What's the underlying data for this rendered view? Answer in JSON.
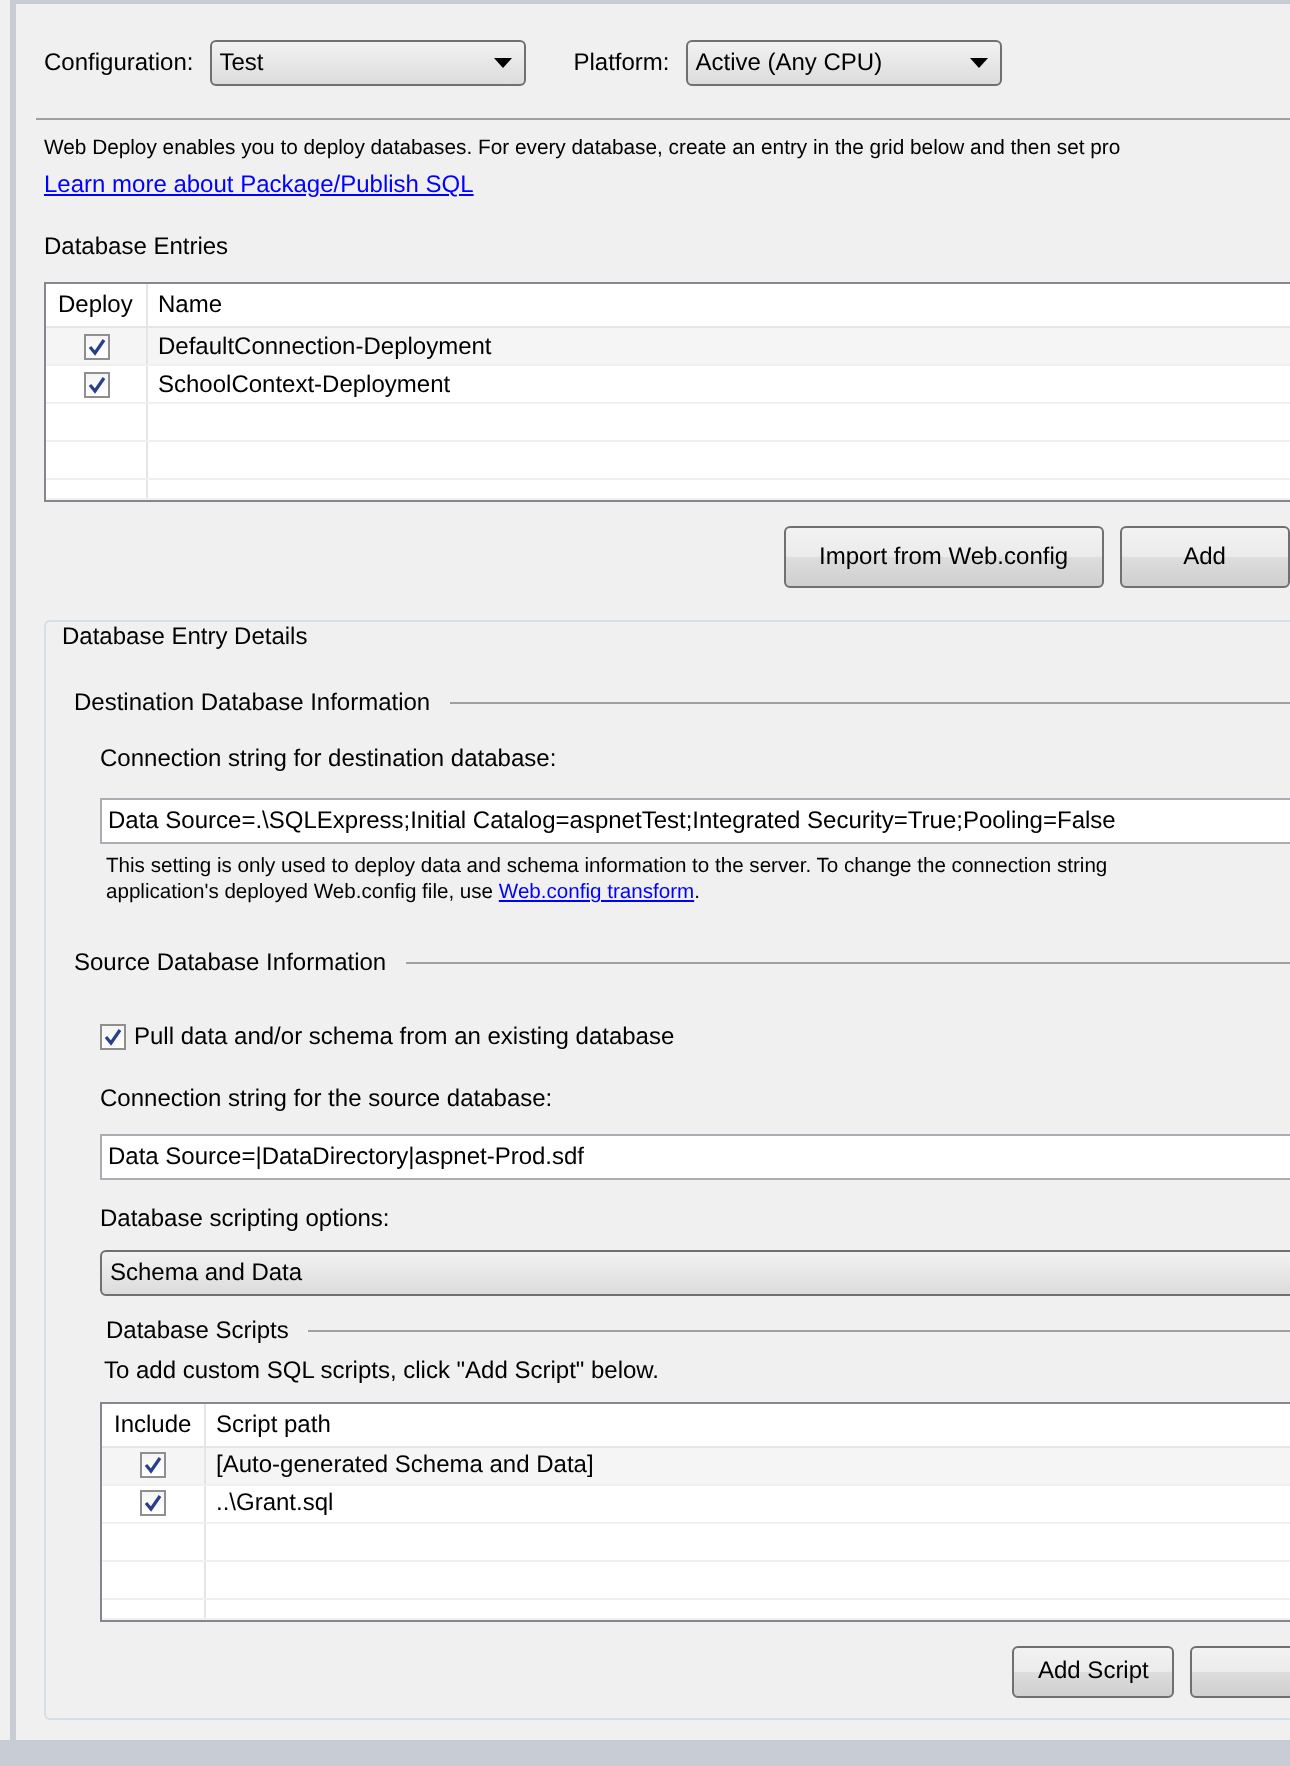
{
  "config": {
    "configuration_label": "Configuration:",
    "configuration_value": "Test",
    "platform_label": "Platform:",
    "platform_value": "Active (Any CPU)"
  },
  "intro": {
    "text": "Web Deploy enables you to deploy databases. For every database, create an entry in the grid below and then set pro",
    "link": "Learn more about Package/Publish SQL"
  },
  "entries": {
    "title": "Database Entries",
    "columns": [
      "Deploy",
      "Name"
    ],
    "rows": [
      {
        "checked": true,
        "name": "DefaultConnection-Deployment"
      },
      {
        "checked": true,
        "name": "SchoolContext-Deployment"
      }
    ]
  },
  "entry_buttons": [
    "Import from Web.config",
    "Add"
  ],
  "details": {
    "title": "Database Entry Details",
    "destination": {
      "title": "Destination Database Information",
      "label": "Connection string for destination database:",
      "value": "Data Source=.\\SQLExpress;Initial Catalog=aspnetTest;Integrated Security=True;Pooling=False",
      "note_line1": "This setting is only used to deploy data and schema information to the server. To change the connection string",
      "note_line2": "application's deployed Web.config file, use ",
      "note_link": "Web.config transform",
      "note_end": "."
    },
    "source": {
      "title": "Source Database Information",
      "pull": {
        "label": "Pull data and/or schema from an existing database",
        "checked": true
      },
      "conn_label": "Connection string for the source database:",
      "conn_value": "Data Source=|DataDirectory|aspnet-Prod.sdf",
      "options_label": "Database scripting options:",
      "options_value": "Schema and Data"
    },
    "scripts": {
      "title": "Database Scripts",
      "hint": "To add custom SQL scripts, click \"Add Script\" below.",
      "columns": [
        "Include",
        "Script path"
      ],
      "rows": [
        {
          "checked": true,
          "path": "[Auto-generated Schema and Data]"
        },
        {
          "checked": true,
          "path": "..\\Grant.sql"
        }
      ],
      "buttons": [
        "Add Script"
      ]
    }
  }
}
